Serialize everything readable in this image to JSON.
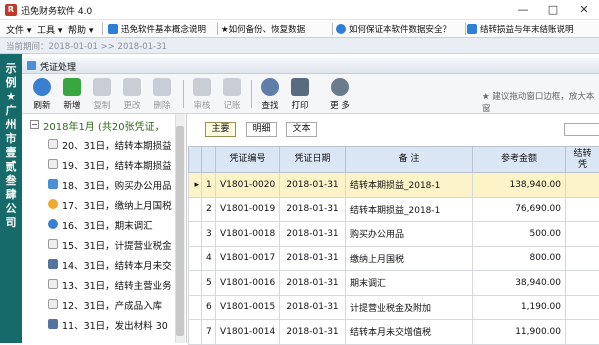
{
  "window": {
    "icon_letter": "R",
    "title": "迅免财务软件 4.0",
    "minimize": "—",
    "maximize": "□",
    "close": "✕"
  },
  "menu": {
    "items": [
      "文件 ▾",
      "工具 ▾",
      "帮助 ▾"
    ],
    "tabs": [
      {
        "label": "迅免软件基本概念说明",
        "icon": "document-icon",
        "color": "#2e7fd6"
      },
      {
        "label": "★如何备份、恢复数据",
        "icon": "backup-icon",
        "color": "#d9a21b"
      },
      {
        "label": "如何保证本软件数据安全？",
        "icon": "help-icon",
        "color": "#2e7fd6"
      },
      {
        "label": "结转损益与年末结账说明",
        "icon": "document-icon",
        "color": "#2e7fd6"
      }
    ]
  },
  "datebar": {
    "text": "当前期间：2018-01-01 >> 2018-01-31"
  },
  "sidebar_tag": {
    "text": "示例★广州市壹贰叁肆公司"
  },
  "panel": {
    "title": "凭证处理"
  },
  "toolbar": {
    "buttons": [
      {
        "label": "刷新",
        "icon": "refresh-icon",
        "color": "#3b7fd0",
        "enabled": true
      },
      {
        "label": "新增",
        "icon": "add-icon",
        "color": "#3aa640",
        "enabled": true
      },
      {
        "label": "复制",
        "icon": "copy-icon",
        "color": "#c9ced6",
        "enabled": false
      },
      {
        "label": "更改",
        "icon": "edit-icon",
        "color": "#c9ced6",
        "enabled": false
      },
      {
        "label": "删除",
        "icon": "delete-icon",
        "color": "#c9ced6",
        "enabled": false
      },
      {
        "label": "审核",
        "icon": "checkmark-icon",
        "color": "#c9ced6",
        "enabled": false
      },
      {
        "label": "记账",
        "icon": "book-icon",
        "color": "#c9ced6",
        "enabled": false
      },
      {
        "label": "查找",
        "icon": "search-icon",
        "color": "#5f7faa",
        "enabled": true
      },
      {
        "label": "打印",
        "icon": "printer-icon",
        "color": "#5a6b80",
        "enabled": true
      },
      {
        "label": "更 多",
        "icon": "gear-icon",
        "color": "#6b7a8c",
        "enabled": true
      }
    ],
    "hint": "★ 建议拖动窗口边框，放大本窗"
  },
  "tree": {
    "root": "2018年1月 (共20张凭证，",
    "items": [
      {
        "label": "20、31日，结转本期损益",
        "icon": "document-icon",
        "color": "#eeeeee"
      },
      {
        "label": "19、31日，结转本期损益",
        "icon": "document-icon",
        "color": "#eeeeee"
      },
      {
        "label": "18、31日，购买办公用品",
        "icon": "monitor-icon",
        "color": "#4a90d9"
      },
      {
        "label": "17、31日，缴纳上月国税",
        "icon": "star-icon",
        "color": "#f0a830"
      },
      {
        "label": "16、31日，期末调汇",
        "icon": "help-icon",
        "color": "#3b7fd0"
      },
      {
        "label": "15、31日，计提营业税金",
        "icon": "document-icon",
        "color": "#eeeeee"
      },
      {
        "label": "14、31日，结转本月未交",
        "icon": "grid-icon",
        "color": "#5573a0"
      },
      {
        "label": "13、31日，结转主营业务",
        "icon": "document-icon",
        "color": "#eeeeee"
      },
      {
        "label": "12、31日，产成品入库",
        "icon": "document-icon",
        "color": "#eeeeee"
      },
      {
        "label": "11、31日，发出材料 30",
        "icon": "grid-icon",
        "color": "#5573a0"
      }
    ]
  },
  "subtabs": [
    "主要",
    "明细",
    "文本"
  ],
  "table": {
    "columns": [
      "",
      "",
      "凭证编号",
      "凭证日期",
      "备 注",
      "参考金额",
      "结转\n凭"
    ],
    "rows": [
      {
        "mark": "▸",
        "idx": "1",
        "no": "V1801-0020",
        "date": "2018-01-31",
        "note": "结转本期损益_2018-1",
        "amount": "138,940.00"
      },
      {
        "mark": "",
        "idx": "2",
        "no": "V1801-0019",
        "date": "2018-01-31",
        "note": "结转本期损益_2018-1",
        "amount": "76,690.00"
      },
      {
        "mark": "",
        "idx": "3",
        "no": "V1801-0018",
        "date": "2018-01-31",
        "note": "购买办公用品",
        "amount": "500.00"
      },
      {
        "mark": "",
        "idx": "4",
        "no": "V1801-0017",
        "date": "2018-01-31",
        "note": "缴纳上月国税",
        "amount": "800.00"
      },
      {
        "mark": "",
        "idx": "5",
        "no": "V1801-0016",
        "date": "2018-01-31",
        "note": "期末调汇",
        "amount": "38,940.00"
      },
      {
        "mark": "",
        "idx": "6",
        "no": "V1801-0015",
        "date": "2018-01-31",
        "note": "计提营业税金及附加",
        "amount": "1,190.00"
      },
      {
        "mark": "",
        "idx": "7",
        "no": "V1801-0014",
        "date": "2018-01-31",
        "note": "结转本月未交增值税",
        "amount": "11,900.00"
      }
    ],
    "selected_row": 0
  }
}
